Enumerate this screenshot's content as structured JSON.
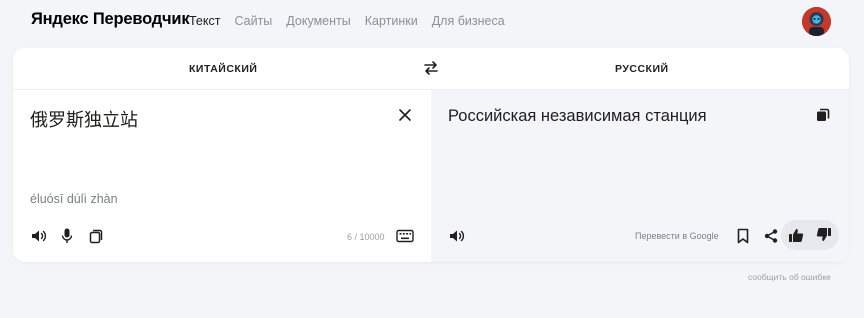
{
  "header": {
    "logo": "Яндекс Переводчик",
    "nav": [
      {
        "label": "Текст",
        "active": true
      },
      {
        "label": "Сайты",
        "active": false
      },
      {
        "label": "Документы",
        "active": false
      },
      {
        "label": "Картинки",
        "active": false
      },
      {
        "label": "Для бизнеса",
        "active": false
      }
    ]
  },
  "languages": {
    "source": "КИТАЙСКИЙ",
    "target": "РУССКИЙ"
  },
  "source": {
    "text": "俄罗斯独立站",
    "transliteration": "éluósī dúlì zhàn",
    "counter": "6 / 10000"
  },
  "target": {
    "text": "Российская независимая станция",
    "translate_google": "Перевести в Google"
  },
  "footer": {
    "report_error": "сообщить об ошибке"
  },
  "colors": {
    "page_bg": "#f4f5f9",
    "card_bg": "#ffffff",
    "target_bg": "#f4f5f9",
    "text": "#21201f",
    "muted": "#8a8f99",
    "icon": "#21201f"
  },
  "icons": {
    "swap": "swap-arrows-icon",
    "clear": "close-icon",
    "speak": "speaker-icon",
    "mic": "microphone-icon",
    "copy": "copy-icon",
    "keyboard": "keyboard-icon",
    "bookmark": "bookmark-icon",
    "share": "share-icon",
    "like": "thumbs-up-icon",
    "dislike": "thumbs-down-icon"
  }
}
